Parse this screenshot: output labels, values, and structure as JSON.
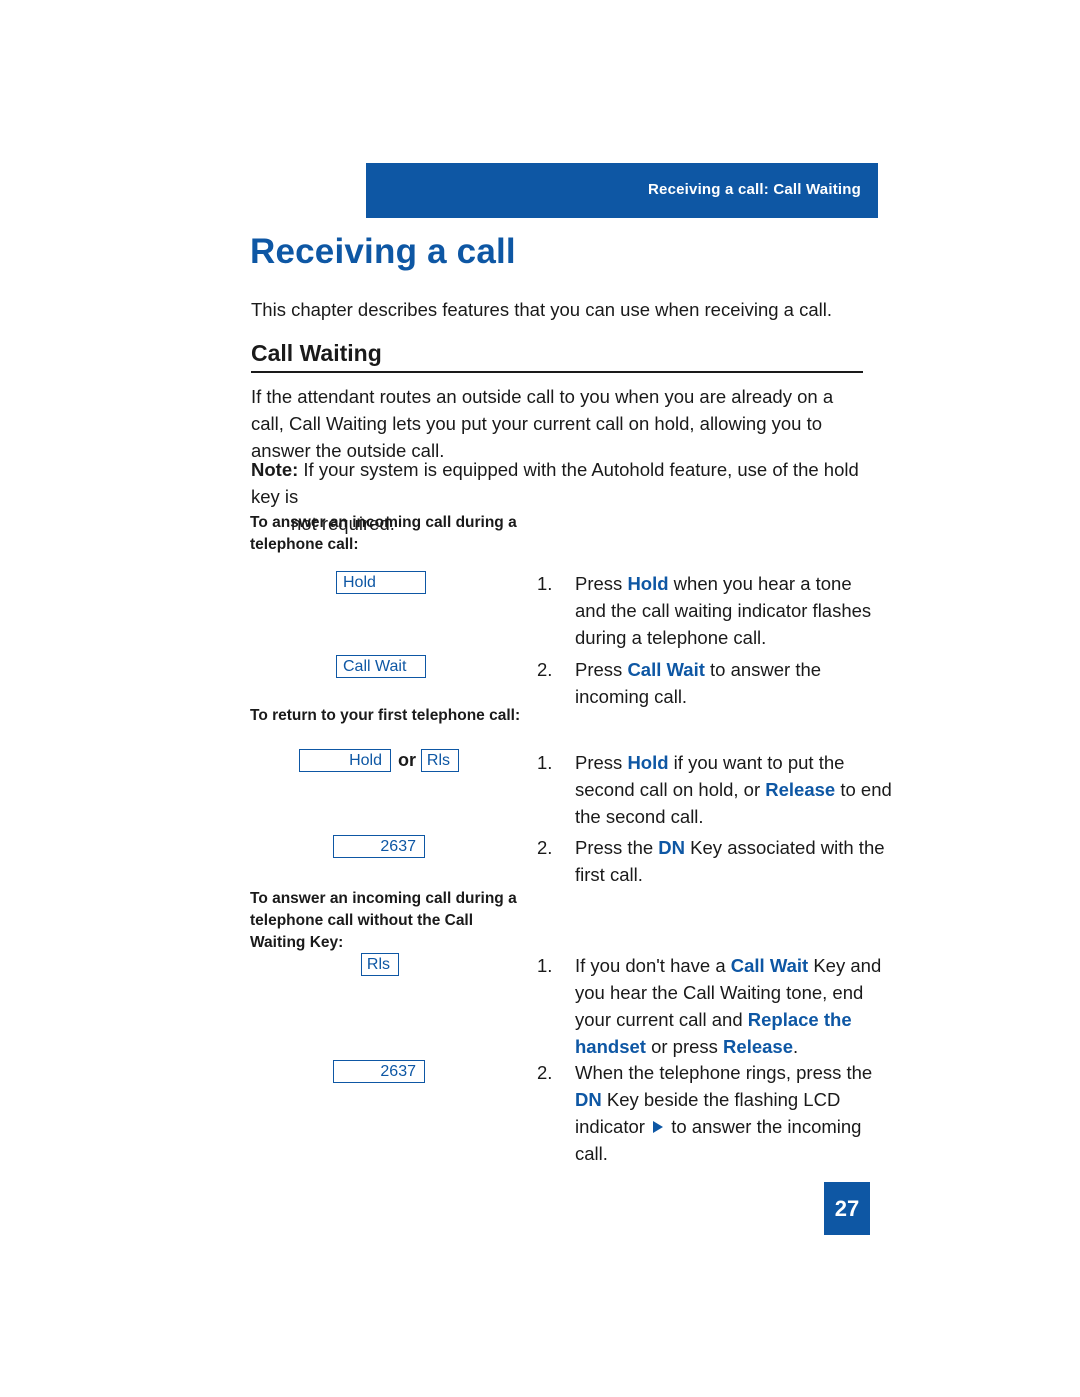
{
  "header": {
    "running_head": "Receiving a call: Call Waiting"
  },
  "title": "Receiving a call",
  "intro": "This chapter describes features that you can use when receiving a call.",
  "section": {
    "heading": "Call Waiting",
    "paragraph": "If the attendant routes an outside call to you when you are already on a call, Call Waiting lets you put your current call on hold, allowing you to answer the outside call.",
    "note_label": "Note:",
    "note_text": " If your system is equipped with the Autohold feature, use of the hold key is",
    "note_text2": "not required."
  },
  "subheads": {
    "one": "To answer an incoming call during a telephone call:",
    "two": "To return to your first telephone call:",
    "three": "To answer an incoming call during a telephone call without the Call Waiting Key:"
  },
  "keys": {
    "hold": "Hold",
    "call_wait": "Call Wait",
    "hold2": "Hold",
    "or": "or",
    "rls": "Rls",
    "dn_2637": "2637",
    "rls2": "Rls",
    "dn_2637_b": "2637"
  },
  "steps": {
    "g1s1": {
      "num": "1.",
      "pre": "Press ",
      "key": "Hold",
      "post": " when you hear a tone and the call waiting indicator flashes during a telephone call."
    },
    "g1s2": {
      "num": "2.",
      "pre": "Press ",
      "key": "Call Wait",
      "post": " to answer the incoming call."
    },
    "g2s1": {
      "num": "1.",
      "pre": "Press ",
      "key": "Hold",
      "mid": " if you want to put the second call on hold, or ",
      "key2": "Release",
      "post": " to end the second call."
    },
    "g2s2": {
      "num": "2.",
      "pre": "Press the ",
      "key": "DN",
      "post": " Key associated with the first call."
    },
    "g3s1": {
      "num": "1.",
      "pre": "If you don't have a ",
      "key": "Call Wait",
      "mid": " Key and you hear the Call Waiting tone, end your current call and ",
      "key2": "Replace the handset",
      "mid2": " or press ",
      "key3": "Release",
      "post": "."
    },
    "g3s2": {
      "num": "2.",
      "pre": "When the telephone rings, press the ",
      "key": "DN",
      "mid": " Key beside the flashing LCD indicator ",
      "post": " to answer the incoming call."
    }
  },
  "page_number": "27",
  "colors": {
    "accent": "#0e57a4",
    "text": "#1a1a1a"
  }
}
